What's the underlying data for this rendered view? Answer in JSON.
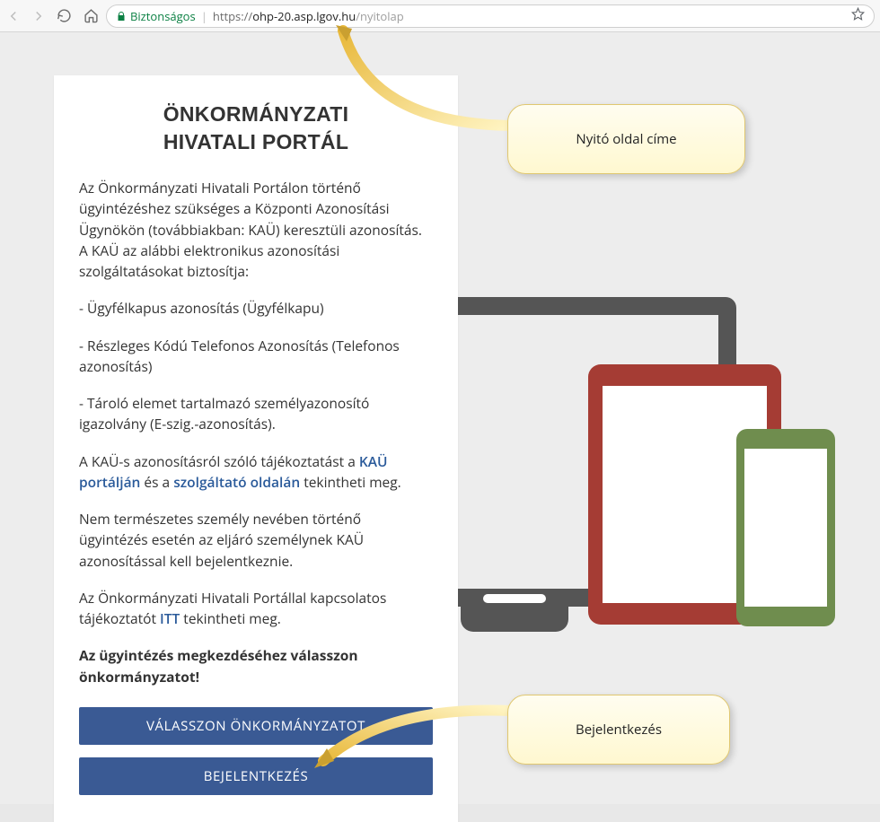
{
  "browser": {
    "secure_label": "Biztonságos",
    "url_scheme": "https://",
    "url_host": "ohp-20.asp.lgov.hu",
    "url_path": "/nyitolap"
  },
  "callouts": {
    "top": "Nyitó oldal címe",
    "bottom": "Bejelentkezés"
  },
  "content": {
    "title_line1": "ÖNKORMÁNYZATI",
    "title_line2": "HIVATALI PORTÁL",
    "intro": "Az Önkormányzati Hivatali Portálon történő ügyintézéshez szükséges a Központi Azonosítási Ügynökön (továbbiakban: KAÜ) keresztüli azonosítás. A KAÜ az alábbi elektronikus azonosítási szolgáltatásokat biztosítja:",
    "bullet1": "- Ügyfélkapus azonosítás (Ügyfélkapu)",
    "bullet2": "- Részleges Kódú Telefonos Azonosítás (Telefonos azonosítás)",
    "bullet3": "- Tároló elemet tartalmazó személyazonosító igazolvány (E-szig.-azonosítás).",
    "kau_pre": "A KAÜ-s azonosításról szóló tájékoztatást a ",
    "kau_link1": "KAÜ portálján",
    "kau_mid": " és a ",
    "kau_link2": "szolgáltató oldalán",
    "kau_post": " tekintheti meg.",
    "nonnat": "Nem természetes személy nevében történő ügyintézés esetén az eljáró személynek KAÜ azonosítással kell bejelentkeznie.",
    "itt_pre": "Az Önkormányzati Hivatali Portállal kapcsolatos tájékoztatót ",
    "itt_link": "ITT",
    "itt_post": " tekintheti meg.",
    "bold_prompt": "Az ügyintézés megkezdéséhez válasszon önkormányzatot!",
    "btn_select": "VÁLASSZON ÖNKORMÁNYZATOT",
    "btn_login": "BEJELENTKEZÉS"
  }
}
